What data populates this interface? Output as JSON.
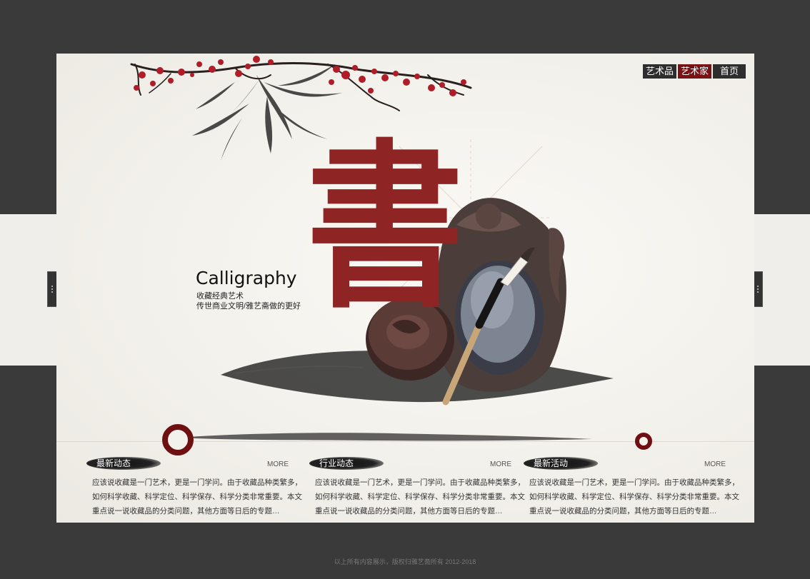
{
  "nav": {
    "items": [
      "艺术品",
      "艺术家",
      "首页"
    ],
    "active_index": 1
  },
  "hero": {
    "title": "Calligraphy",
    "subtitle_line1": "收藏经典艺术",
    "subtitle_line2": "传世商业文明/雅艺斋做的更好",
    "big_character": "書"
  },
  "columns": [
    {
      "title": "最新动态",
      "more": "MORE",
      "lines": [
        "应该说收藏是一门艺术，更是一门学问。由于收藏品种类繁多，",
        "如何科学收藏、科学定位、科学保存、科学分类非常重要。本文",
        "重点说一说收藏品的分类问题，其他方面等日后的专题…"
      ]
    },
    {
      "title": "行业动态",
      "more": "MORE",
      "lines": [
        "应该说收藏是一门艺术，更是一门学问。由于收藏品种类繁多，",
        "如何科学收藏、科学定位、科学保存、科学分类非常重要。本文",
        "重点说一说收藏品的分类问题，其他方面等日后的专题…"
      ]
    },
    {
      "title": "最新活动",
      "more": "MORE",
      "lines": [
        "应该说收藏是一门艺术，更是一门学问。由于收藏品种类繁多，",
        "如何科学收藏、科学定位、科学保存、科学分类非常重要。本文",
        "重点说一说收藏品的分类问题，其他方面等日后的专题…"
      ]
    }
  ],
  "footer": "以上所有内容展示，版权归雅艺斋所有   2012-2018",
  "colors": {
    "accent": "#7a1215",
    "ink": "#111111",
    "background": "#3a3a3a"
  }
}
